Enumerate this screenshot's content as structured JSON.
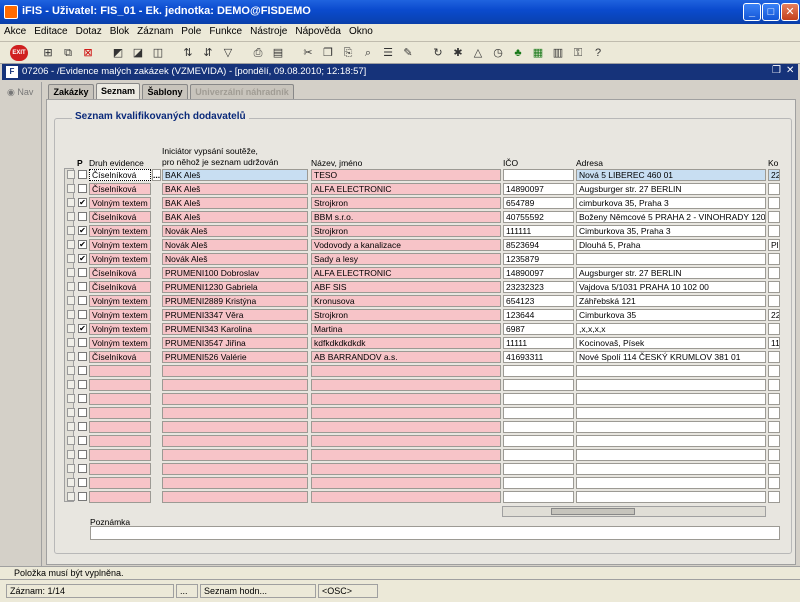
{
  "window": {
    "title": "iFIS - Uživatel: FIS_01 - Ek. jednotka: DEMO@FISDEMO"
  },
  "menu": [
    "Akce",
    "Editace",
    "Dotaz",
    "Blok",
    "Záznam",
    "Pole",
    "Funkce",
    "Nástroje",
    "Nápověda",
    "Okno"
  ],
  "toolbar": {
    "exit_label": "EXIT"
  },
  "form": {
    "title": "07206 - /Evidence malých zakázek (VZMEVIDA) - [pondělí, 09.08.2010; 12:18:57]",
    "nav_label": "Nav",
    "tabs": [
      "Zakázky",
      "Seznam",
      "Šablony",
      "Univerzální náhradník"
    ],
    "group_title": "Seznam kvalifikovaných dodavatelů",
    "headers": {
      "p": "P",
      "druh": "Druh evidence",
      "iniciator": "Iniciátor vypsání soutěže,",
      "iniciator2": "pro něhož je seznam udržován",
      "nazev": "Název, jméno",
      "ico": "IČO",
      "adresa": "Adresa",
      "ko": "Ko"
    },
    "rows": [
      {
        "checked": false,
        "druh": "Číselníková",
        "init": "BAK Aleš",
        "nazev": "TESO",
        "ico": "",
        "adresa": "Nová 5 LIBEREC 460 01",
        "ko": "22"
      },
      {
        "checked": false,
        "druh": "Číselníková",
        "init": "BAK Aleš",
        "nazev": "ALFA ELECTRONIC",
        "ico": "14890097",
        "adresa": "Augsburger str. 27 BERLIN",
        "ko": ""
      },
      {
        "checked": true,
        "druh": "Volným textem",
        "init": "BAK Aleš",
        "nazev": "Strojkron",
        "ico": "654789",
        "adresa": "cimburkova 35, Praha 3",
        "ko": ""
      },
      {
        "checked": false,
        "druh": "Číselníková",
        "init": "BAK Aleš",
        "nazev": "BBM s.r.o.",
        "ico": "40755592",
        "adresa": "Boženy Němcové 5 PRAHA 2 - VINOHRADY 120 0",
        "ko": ""
      },
      {
        "checked": true,
        "druh": "Volným textem",
        "init": "Novák Aleš",
        "nazev": "Strojkron",
        "ico": "111111",
        "adresa": "Cimburkova 35, Praha 3",
        "ko": ""
      },
      {
        "checked": true,
        "druh": "Volným textem",
        "init": "Novák Aleš",
        "nazev": "Vodovody a kanalizace",
        "ico": "8523694",
        "adresa": "Dlouhá 5, Praha",
        "ko": "Pl"
      },
      {
        "checked": true,
        "druh": "Volným textem",
        "init": "Novák Aleš",
        "nazev": "Sady a lesy",
        "ico": "1235879",
        "adresa": "",
        "ko": ""
      },
      {
        "checked": false,
        "druh": "Číselníková",
        "init": "PRUMENI100 Dobroslav",
        "nazev": "ALFA ELECTRONIC",
        "ico": "14890097",
        "adresa": "Augsburger str. 27 BERLIN",
        "ko": ""
      },
      {
        "checked": false,
        "druh": "Číselníková",
        "init": "PRUMENI1230 Gabriela",
        "nazev": "ABF SIS",
        "ico": "23232323",
        "adresa": "Vajdova 5/1031 PRAHA 10 102 00",
        "ko": ""
      },
      {
        "checked": false,
        "druh": "Volným textem",
        "init": "PRUMENI2889 Kristýna",
        "nazev": "Kronusova",
        "ico": "654123",
        "adresa": "Záhřebská 121",
        "ko": ""
      },
      {
        "checked": false,
        "druh": "Volným textem",
        "init": "PRUMENI3347 Věra",
        "nazev": "Strojkron",
        "ico": "123644",
        "adresa": "Cimburkova 35",
        "ko": "22"
      },
      {
        "checked": true,
        "druh": "Volným textem",
        "init": "PRUMENI343 Karolina",
        "nazev": "Martina",
        "ico": "6987",
        "adresa": ",x,x,x,x",
        "ko": ""
      },
      {
        "checked": false,
        "druh": "Volným textem",
        "init": "PRUMENI3547 Jiřina",
        "nazev": "kdfkdkdkdkdk",
        "ico": "11111",
        "adresa": "Kocinovaš, Písek",
        "ko": "11"
      },
      {
        "checked": false,
        "druh": "Číselníková",
        "init": "PRUMENI526 Valérie",
        "nazev": "AB BARRANDOV a.s.",
        "ico": "41693311",
        "adresa": "Nové Spolí 114 ČESKÝ KRUMLOV 381 01",
        "ko": ""
      }
    ],
    "note_label": "Poznámka",
    "picker_label": "..."
  },
  "message": "Položka musí být vyplněna.",
  "status": {
    "record": "Záznam: 1/14",
    "dots": "...",
    "list": "Seznam hodn...",
    "osc": "<OSC>"
  }
}
